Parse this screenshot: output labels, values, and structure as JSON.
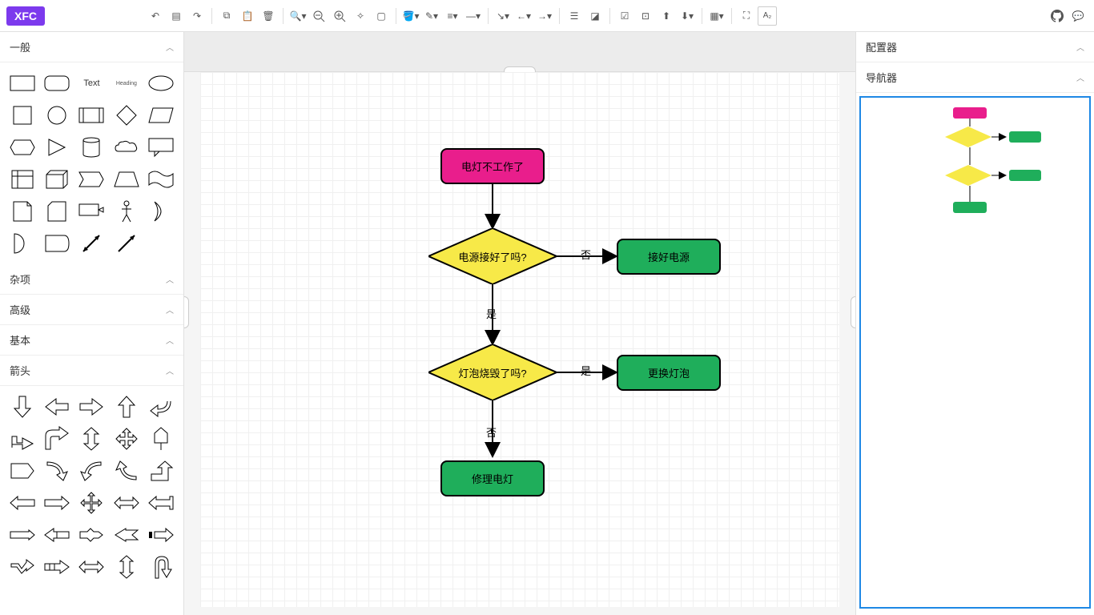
{
  "app": {
    "logo": "XFC"
  },
  "toolbar_icons": [
    "undo",
    "page",
    "redo",
    "copy",
    "paste",
    "delete",
    "zoom-search",
    "zoom-out",
    "zoom-in",
    "fit",
    "frame",
    "fill",
    "stroke",
    "line-style",
    "line",
    "connector",
    "arrow-start",
    "arrow-end",
    "layers",
    "shadow",
    "image",
    "group",
    "bring-front",
    "send-back",
    "grid",
    "fullscreen",
    "format"
  ],
  "toolbar_right": [
    "github",
    "comment"
  ],
  "sidebar": {
    "sections": [
      {
        "id": "general",
        "label": "一般",
        "open": true
      },
      {
        "id": "misc",
        "label": "杂项",
        "open": false
      },
      {
        "id": "advanced",
        "label": "高级",
        "open": false
      },
      {
        "id": "basic",
        "label": "基本",
        "open": false
      },
      {
        "id": "arrows",
        "label": "箭头",
        "open": true
      }
    ],
    "text_shape": "Text",
    "heading_shape": "Heading"
  },
  "right_panel": {
    "config_label": "配置器",
    "navigator_label": "导航器"
  },
  "flowchart": {
    "start": "电灯不工作了",
    "decision1": "电源接好了吗?",
    "edge1_no": "否",
    "action1": "接好电源",
    "edge1_yes": "是",
    "decision2": "灯泡烧毁了吗?",
    "edge2_yes": "是",
    "action2": "更换灯泡",
    "edge2_no": "否",
    "action3": "修理电灯"
  },
  "colors": {
    "pink": "#e91e8c",
    "yellow": "#f7e948",
    "green": "#1fae5b"
  }
}
